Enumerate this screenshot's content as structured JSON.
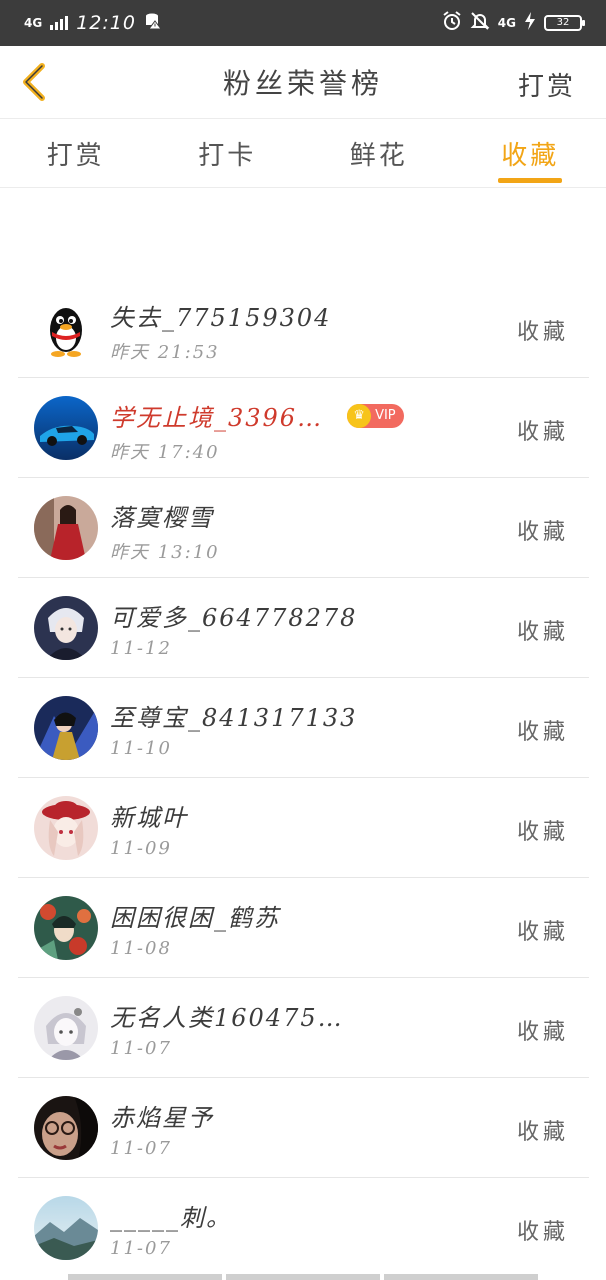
{
  "status_bar": {
    "network_left": "4G",
    "time": "12:10",
    "network_right": "4G",
    "battery": "32"
  },
  "header": {
    "title": "粉丝荣誉榜",
    "right_action": "打赏"
  },
  "tabs": [
    {
      "label": "打赏",
      "active": false
    },
    {
      "label": "打卡",
      "active": false
    },
    {
      "label": "鲜花",
      "active": false
    },
    {
      "label": "收藏",
      "active": true
    }
  ],
  "colors": {
    "accent": "#f2a516",
    "vip_name": "#cf3a2c",
    "status_bar": "#3c3c3c"
  },
  "fans": [
    {
      "name": "失去_775159304",
      "time": "昨天 21:53",
      "action": "收藏",
      "avatar": "penguin-avatar"
    },
    {
      "name": "学无止境_3396…",
      "time": "昨天 17:40",
      "action": "收藏",
      "avatar": "car-avatar",
      "badge": "VIP"
    },
    {
      "name": "落寞樱雪",
      "time": "昨天 13:10",
      "action": "收藏",
      "avatar": "girl-red-dress-avatar"
    },
    {
      "name": "可爱多_664778278",
      "time": "11-12",
      "action": "收藏",
      "avatar": "anime-boy-avatar"
    },
    {
      "name": "至尊宝_841317133",
      "time": "11-10",
      "action": "收藏",
      "avatar": "hero-avatar"
    },
    {
      "name": "新城叶",
      "time": "11-09",
      "action": "收藏",
      "avatar": "anime-girl-hat-avatar"
    },
    {
      "name": "困困很困_鹤苏",
      "time": "11-08",
      "action": "收藏",
      "avatar": "illustration-avatar"
    },
    {
      "name": "无名人类160475…",
      "time": "11-07",
      "action": "收藏",
      "avatar": "sketch-girl-avatar"
    },
    {
      "name": "赤焰星予",
      "time": "11-07",
      "action": "收藏",
      "avatar": "glasses-girl-avatar"
    },
    {
      "name": "_____刺。",
      "time": "11-07",
      "action": "收藏",
      "avatar": "landscape-avatar"
    }
  ]
}
